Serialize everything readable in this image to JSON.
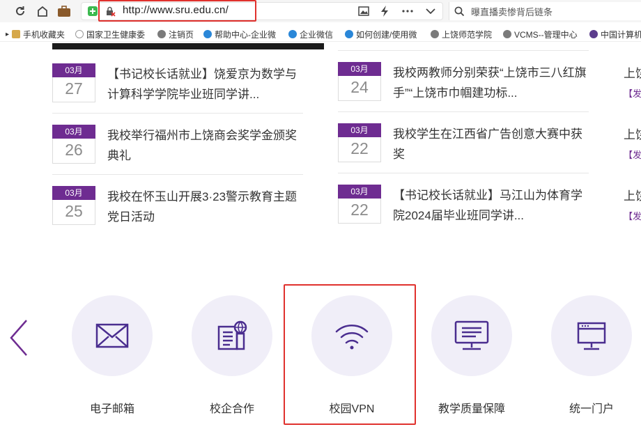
{
  "browser": {
    "url": "http://www.sru.edu.cn/",
    "search_placeholder": "曝直播卖惨背后链条"
  },
  "bookmarks": [
    {
      "label": "手机收藏夹",
      "icon": "folder-icon",
      "color": "#d6a84a"
    },
    {
      "label": "国家卫生健康委",
      "icon": "site-icon",
      "color": "#999999"
    },
    {
      "label": "注销页",
      "icon": "globe-icon",
      "color": "#7a7a7a"
    },
    {
      "label": "帮助中心-企业微",
      "icon": "wecom-icon",
      "color": "#2a87d8"
    },
    {
      "label": "企业微信",
      "icon": "wecom-icon",
      "color": "#2a87d8"
    },
    {
      "label": "如何创建/使用微",
      "icon": "wecom-icon",
      "color": "#2a87d8"
    },
    {
      "label": "上饶师范学院",
      "icon": "globe-icon",
      "color": "#7a7a7a"
    },
    {
      "label": "VCMS--管理中心",
      "icon": "globe-icon",
      "color": "#7a7a7a"
    },
    {
      "label": "中国计算机",
      "icon": "ccf-icon",
      "color": "#5b3c8c"
    }
  ],
  "news": {
    "col1": [
      {
        "month": "03月",
        "day": "27",
        "title": "【书记校长话就业】饶爱京为数学与计算科学学院毕业班同学讲..."
      },
      {
        "month": "03月",
        "day": "26",
        "title": "我校举行福州市上饶商会奖学金颁奖典礼"
      },
      {
        "month": "03月",
        "day": "25",
        "title": "我校在怀玉山开展3·23警示教育主题党日活动"
      }
    ],
    "col2": [
      {
        "month": "03月",
        "day": "24",
        "title": "我校两教师分别荣获“上饶市三八红旗手”“上饶市巾帼建功标..."
      },
      {
        "month": "03月",
        "day": "22",
        "title": "我校学生在江西省广告创意大赛中获奖"
      },
      {
        "month": "03月",
        "day": "22",
        "title": "【书记校长话就业】马江山为体育学院2024届毕业班同学讲..."
      }
    ],
    "col3": [
      {
        "title": "上饶",
        "tag": "【发"
      },
      {
        "title": "上饶",
        "tag": "【发"
      },
      {
        "title": "上饶",
        "tag": "【发"
      }
    ]
  },
  "services": [
    {
      "label": "电子邮箱",
      "icon": "mail-icon"
    },
    {
      "label": "校企合作",
      "icon": "building-globe-icon"
    },
    {
      "label": "校园VPN",
      "icon": "wifi-icon"
    },
    {
      "label": "教学质量保障",
      "icon": "monitor-icon"
    },
    {
      "label": "统一门户",
      "icon": "portal-icon"
    }
  ],
  "colors": {
    "accent": "#6e2c91",
    "icon": "#4a2d8f",
    "circle_bg": "#f0eef8",
    "highlight": "#e0312d"
  }
}
